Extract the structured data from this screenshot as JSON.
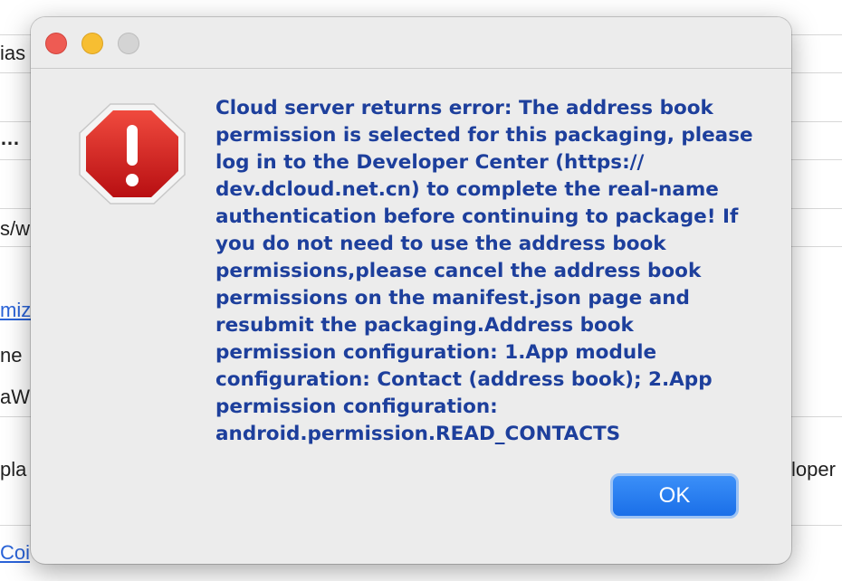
{
  "background": {
    "fragments": [
      "ias",
      "…",
      "s/w",
      "miz",
      "ne",
      "aW",
      "pla",
      "loper",
      "Coi"
    ]
  },
  "dialog": {
    "message": "Cloud server returns error: The address book permission is selected for this packaging, please log in to the Developer Center (https:// dev.dcloud.net.cn) to complete the real-name authentication before continuing to package! If you do not need to use the address book permissions,please cancel the address book permissions on the manifest.json page and resubmit the packaging.Address book permission configuration: 1.App module configuration: Contact (address book); 2.App permission configuration: android.permission.READ_CONTACTS",
    "ok_label": "OK",
    "icon": "stop-alert-icon"
  },
  "colors": {
    "message_text": "#1d3f9c",
    "button_accent": "#1a6fe8",
    "alert_red": "#d11f1f"
  }
}
